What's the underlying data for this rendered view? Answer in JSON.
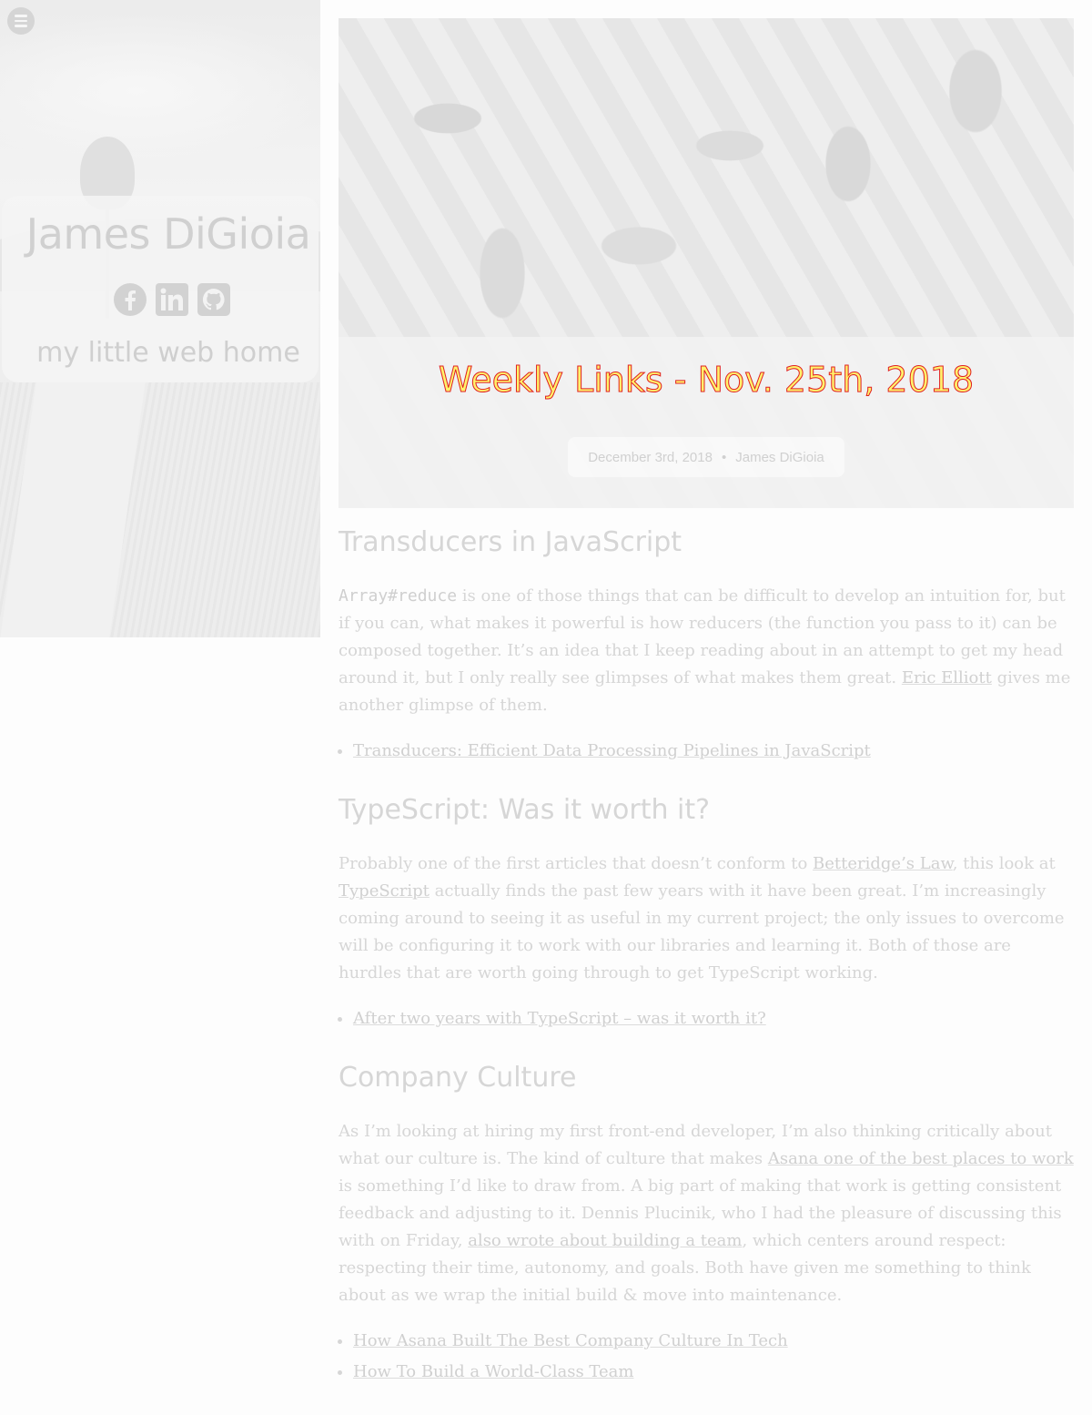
{
  "sidebar": {
    "name": "James DiGioia",
    "tagline": "my little web home",
    "menu_icon": "hamburger-icon",
    "social": [
      {
        "icon": "facebook-icon"
      },
      {
        "icon": "linkedin-icon"
      },
      {
        "icon": "github-icon"
      }
    ]
  },
  "post": {
    "title": "Weekly Links - Nov. 25th, 2018",
    "date": "December 3rd, 2018",
    "separator": "•",
    "author": "James DiGioia"
  },
  "sections": [
    {
      "heading": "Transducers in JavaScript",
      "code": "Array#reduce",
      "p1": " is one of those things that can be difficult to develop an intuition for, but if you can, what makes it powerful is how reducers (the function you pass to it) can be composed together. It’s an idea that I keep reading about in an attempt to get my head around it, but I only really see glimpses of what makes them great. ",
      "link1": "Eric Elliott",
      "p2": " gives me another glimpse of them.",
      "list": [
        "Transducers: Efficient Data Processing Pipelines in JavaScript"
      ]
    },
    {
      "heading": "TypeScript: Was it worth it?",
      "p1": "Probably one of the first articles that doesn’t conform to ",
      "link1": "Betteridge’s Law",
      "p2": ", this look at ",
      "link2": "TypeScript",
      "p3": " actually finds the past few years with it have been great. I’m increasingly coming around to seeing it as useful in my current project; the only issues to overcome will be configuring it to work with our libraries and learning it. Both of those are hurdles that are worth going through to get TypeScript working.",
      "list": [
        "After two years with TypeScript – was it worth it?"
      ]
    },
    {
      "heading": "Company Culture",
      "p1": "As I’m looking at hiring my first front-end developer, I’m also thinking critically about what our culture is. The kind of culture that makes ",
      "link1": "Asana one of the best places to work",
      "p2": " is something I’d like to draw from. A big part of making that work is getting consistent feedback and adjusting to it. Dennis Plucinik, who I had the pleasure of discussing this with on Friday, ",
      "link2": "also wrote about building a team",
      "p3": ", which centers around respect: respecting their time, autonomy, and goals. Both have given me something to think about as we wrap the initial build & move into maintenance.",
      "list": [
        "How Asana Built The Best Company Culture In Tech",
        "How To Build a World-Class Team"
      ]
    }
  ]
}
